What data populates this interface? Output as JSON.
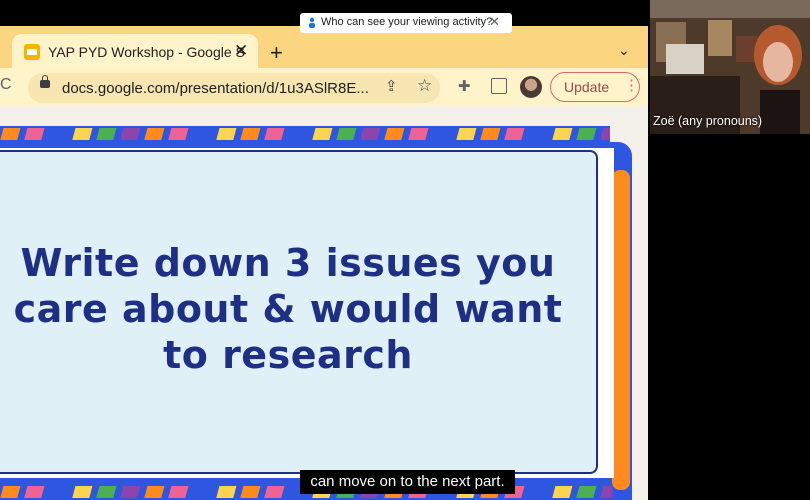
{
  "banner": {
    "text": "Who can see your viewing activity?",
    "close": "✕"
  },
  "browser": {
    "tab_title": "YAP PYD Workshop - Google S",
    "tab_close": "✕",
    "new_tab": "+",
    "tab_menu": "⌄",
    "url": "docs.google.com/presentation/d/1u3ASlR8E...",
    "update_label": "Update",
    "update_menu": "⋮",
    "reload": "C"
  },
  "slide": {
    "headline_lines": [
      "Write down 3 issues you",
      "care about & would want",
      "to research"
    ],
    "stripe_colors": [
      "#ff8a1e",
      "#f06292",
      "#2f56e0",
      "#ffd54f",
      "#4caf50",
      "#8e44ad",
      "#ff8a1e",
      "#f06292",
      "#2f56e0",
      "#ffd54f"
    ]
  },
  "caption": {
    "text": "can move on to the next part."
  },
  "participant": {
    "name": "Zoë (any pronouns)"
  }
}
